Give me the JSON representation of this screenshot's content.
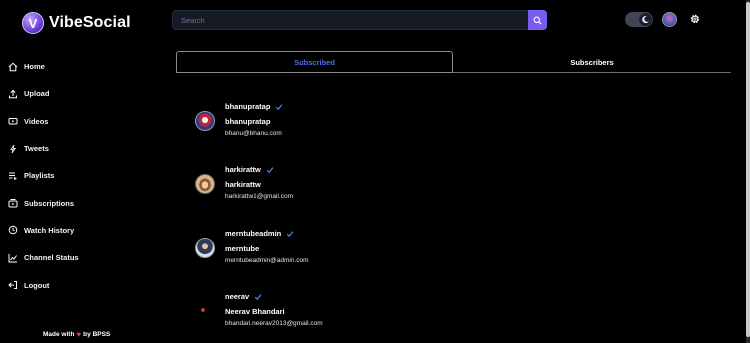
{
  "app": {
    "title": "VibeSocial",
    "logo_letter": "V"
  },
  "search": {
    "placeholder": "Search"
  },
  "sidebar": {
    "items": [
      {
        "label": "Home",
        "icon": "home-icon"
      },
      {
        "label": "Upload",
        "icon": "upload-icon"
      },
      {
        "label": "Videos",
        "icon": "video-icon"
      },
      {
        "label": "Tweets",
        "icon": "bolt-icon"
      },
      {
        "label": "Playlists",
        "icon": "playlist-icon"
      },
      {
        "label": "Subscriptions",
        "icon": "subscriptions-icon"
      },
      {
        "label": "Watch History",
        "icon": "history-icon"
      },
      {
        "label": "Channel Status",
        "icon": "stats-icon"
      },
      {
        "label": "Logout",
        "icon": "logout-icon"
      }
    ],
    "footer": {
      "prefix": "Made with",
      "suffix": "by BPSS"
    }
  },
  "tabs": {
    "subscribed": "Subscribed",
    "subscribers": "Subscribers",
    "active": "subscribed"
  },
  "channels": [
    {
      "username": "bhanupratap",
      "name": "bhanupratap",
      "email": "bhanu@bhanu.com",
      "verified": true
    },
    {
      "username": "harkirattw",
      "name": "harkirattw",
      "email": "harkirattw1@gmail.com",
      "verified": true
    },
    {
      "username": "merntubeadmin",
      "name": "merntube",
      "email": "merntubeadmin@admin.com",
      "verified": true
    },
    {
      "username": "neerav",
      "name": "Neerav Bhandari",
      "email": "bhandari.neerav2013@gmail.com",
      "verified": true
    }
  ],
  "colors": {
    "accent": "#7b5cf0",
    "tab_active": "#4f6cf0",
    "verified": "#4f8ff7",
    "background": "#000000"
  }
}
